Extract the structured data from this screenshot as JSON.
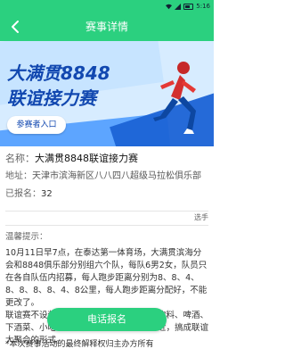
{
  "status_bar": {
    "time": "5:16"
  },
  "app_bar": {
    "title": "赛事详情"
  },
  "banner": {
    "headline_line1": "大满贯8848",
    "headline_line2": "联谊接力赛",
    "enter_button": "参赛者入口"
  },
  "event": {
    "name_label": "名称：",
    "name_value": "大满贯8848联谊接力赛",
    "address_label": "地址：",
    "address_value": "天津市滨海新区八八四八超级马拉松俱乐部",
    "registered_label": "已报名：",
    "registered_count": "32",
    "tag": "选手"
  },
  "tips": {
    "header": "温馨提示：",
    "paragraph1": "10月11日早7点，在泰达第一体育场，大满贯滨海分会和8848俱乐部分别组六个队，每队6男2女，队员只在各自队伍内招募，每人跑步距离分别为8、8、4、8、8、8、8、4、8公里，每人跑步距离分配好，不能更改了。",
    "paragraph2": "联谊赛不设奖金，补给丰富，补给有水、饮料、啤酒、下酒菜、小吃、西瓜，补给点设在跑道附近，搞成联谊大聚会的形式。"
  },
  "call_button": "电话报名",
  "bottom_note": "*本次赛事活动的最终解释权归主办方所有"
}
